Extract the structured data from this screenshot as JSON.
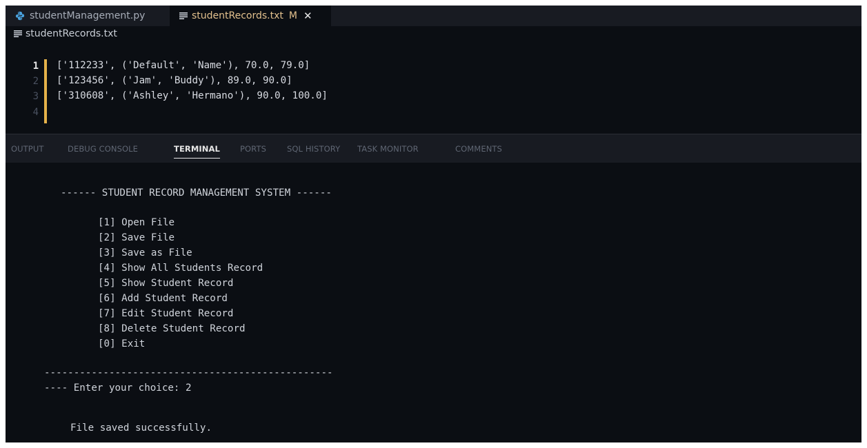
{
  "tabs": [
    {
      "label": "studentManagement.py",
      "icon": "python-icon"
    },
    {
      "label": "studentRecords.txt",
      "icon": "text-file-icon",
      "modified": "M",
      "close": "✕"
    }
  ],
  "breadcrumb": {
    "file": "studentRecords.txt"
  },
  "editor": {
    "lines": [
      {
        "num": "1",
        "text": "['112233', ('Default', 'Name'), 70.0, 79.0]"
      },
      {
        "num": "2",
        "text": "['123456', ('Jam', 'Buddy'), 89.0, 90.0]"
      },
      {
        "num": "3",
        "text": "['310608', ('Ashley', 'Hermano'), 90.0, 100.0]"
      },
      {
        "num": "4",
        "text": ""
      }
    ]
  },
  "panel": {
    "tabs": [
      "OUTPUT",
      "DEBUG CONSOLE",
      "TERMINAL",
      "PORTS",
      "SQL HISTORY",
      "TASK MONITOR",
      "COMMENTS"
    ],
    "active": "TERMINAL"
  },
  "terminal": {
    "title": "------ STUDENT RECORD MANAGEMENT SYSTEM ------",
    "menu": [
      "[1] Open File",
      "[2] Save File",
      "[3] Save as File",
      "[4] Show All Students Record",
      "[5] Show Student Record",
      "[6] Add Student Record",
      "[7] Edit Student Record",
      "[8] Delete Student Record",
      "[0] Exit"
    ],
    "separator": "-------------------------------------------------",
    "prompt": "---- Enter your choice: 2",
    "message": "File saved successfully."
  },
  "colors": {
    "accent_modified": "#e2c08d",
    "background": "#0b0e13",
    "tabbar": "#181b22"
  }
}
